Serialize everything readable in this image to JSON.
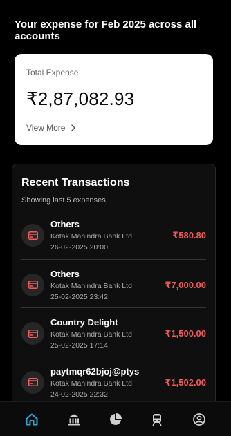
{
  "heading": "Your expense for Feb 2025 across all accounts",
  "total": {
    "label": "Total Expense",
    "amount": "₹2,87,082.93",
    "view_more": "View More"
  },
  "recent": {
    "title": "Recent Transactions",
    "subtitle": "Showing last 5 expenses",
    "items": [
      {
        "name": "Others",
        "bank": "Kotak Mahindra Bank Ltd",
        "date": "26-02-2025 20:00",
        "amount": "₹580.80",
        "icon": "card-icon"
      },
      {
        "name": "Others",
        "bank": "Kotak Mahindra Bank Ltd",
        "date": "25-02-2025 23:42",
        "amount": "₹7,000.00",
        "icon": "card-icon"
      },
      {
        "name": "Country Delight",
        "bank": "Kotak Mahindra Bank Ltd",
        "date": "25-02-2025 17:14",
        "amount": "₹1,500.00",
        "icon": "card-icon"
      },
      {
        "name": "paytmqr62bjoj@ptys",
        "bank": "Kotak Mahindra Bank Ltd",
        "date": "24-02-2025 22:32",
        "amount": "₹1,502.00",
        "icon": "card-icon"
      }
    ]
  },
  "nav": {
    "items": [
      {
        "icon": "home-icon",
        "active": true
      },
      {
        "icon": "bank-icon",
        "active": false
      },
      {
        "icon": "pie-chart-icon",
        "active": false
      },
      {
        "icon": "train-icon",
        "active": false
      },
      {
        "icon": "profile-icon",
        "active": false
      }
    ]
  },
  "colors": {
    "background": "#000000",
    "card": "#ffffff",
    "expense_red": "#f05a5a",
    "active_nav": "#2aa8d8",
    "inactive_nav": "#cfcfcf"
  }
}
